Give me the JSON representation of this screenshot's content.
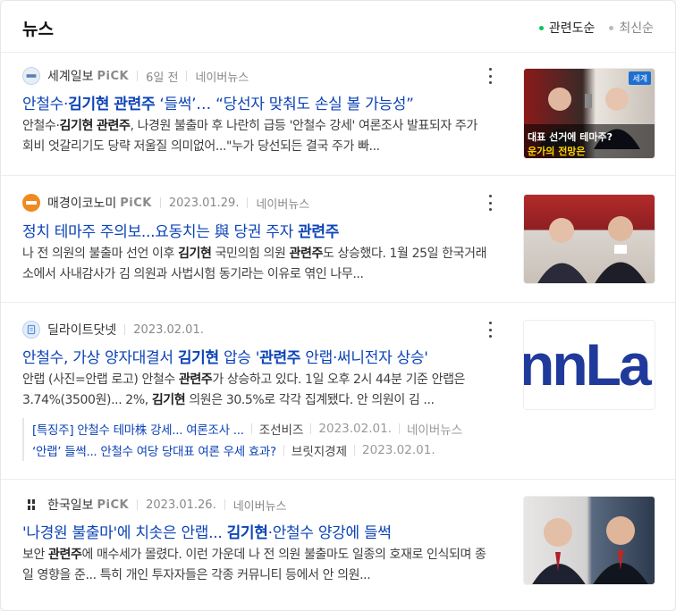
{
  "header": {
    "title": "뉴스",
    "sort_relevance": "관련도순",
    "sort_latest": "최신순"
  },
  "colors": {
    "accent": "#03c75a",
    "link": "#0c43b7"
  },
  "articles": [
    {
      "source": "세계일보",
      "pick": "PiCK",
      "time": "6일 전",
      "portal": "네이버뉴스",
      "headline": [
        "안철수·",
        "김기현",
        " ",
        "관련주",
        " ‘들썩’… “당선자 맞춰도 손실 볼 가능성”"
      ],
      "desc": [
        "안철수·",
        "김기현",
        " ",
        "관련주",
        ", 나경원 불출마 후 나란히 급등 '안철수 강세' 여론조사 발표되자 주가 회비 엇갈리기도 당략 저울질 의미없어...\"누가 당선되든 결국 주가 빠..."
      ],
      "thumb_text": [
        "대표 선거에 테마주?",
        "운가의 전망은"
      ],
      "thumb_badge": "세계"
    },
    {
      "source": "매경이코노미",
      "pick": "PiCK",
      "time": "2023.01.29.",
      "portal": "네이버뉴스",
      "headline": [
        "정치 테마주 주의보...요동치는 與 당권 주자 ",
        "관련주"
      ],
      "desc": [
        "나 전 의원의 불출마 선언 이후 ",
        "김기현",
        " 국민의힘 의원 ",
        "관련주",
        "도 상승했다. 1월 25일 한국거래소에서 사내감사가 김 의원과 사법시험 동기라는 이유로 엮인 나무..."
      ]
    },
    {
      "source": "딜라이트닷넷",
      "time": "2023.02.01.",
      "headline": [
        "안철수, 가상 양자대결서 ",
        "김기현",
        " 압승 '",
        "관련주",
        " 안랩·써니전자 상승'"
      ],
      "desc": [
        "안랩 (사진=안랩 로고) 안철수 ",
        "관련주",
        "가 상승하고 있다. 1일 오후 2시 44분 기준 안랩은 3.74%(3500원)... 2%, ",
        "김기현",
        " 의원은 30.5%로 각각 집계됐다. 안 의원이 김 ..."
      ],
      "thumb_text": "nnLa",
      "related": [
        {
          "title": "[특징주] 안철수 테마株 강세... 여론조사 ...",
          "source": "조선비즈",
          "date": "2023.02.01.",
          "portal": "네이버뉴스"
        },
        {
          "title": "‘안랩’ 들썩... 안철수 여당 당대표 여론 우세 효과?",
          "source": "브릿지경제",
          "date": "2023.02.01."
        }
      ]
    },
    {
      "source": "한국일보",
      "pick": "PiCK",
      "time": "2023.01.26.",
      "portal": "네이버뉴스",
      "headline": [
        "'나경원 불출마'에 치솟은 안랩... ",
        "김기현",
        "·안철수 양강에 들썩"
      ],
      "desc": [
        "보안 ",
        "관련주",
        "에 매수세가 몰렸다. 이런 가운데 나 전 의원 불출마도 일종의 호재로 인식되며 종일 영향을 준... 특히 개인 투자자들은 각종 커뮤니티 등에서 안 의원..."
      ]
    }
  ]
}
